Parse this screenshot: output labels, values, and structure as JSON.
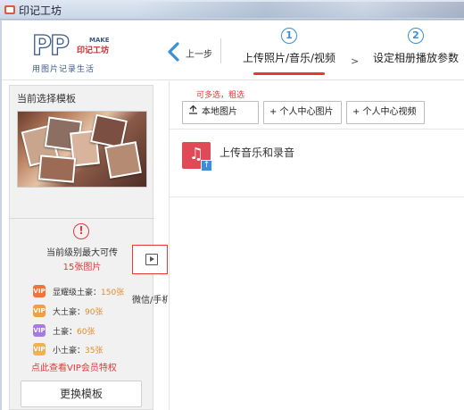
{
  "window": {
    "title": "印记工坊"
  },
  "logo": {
    "pp": "PP",
    "make": "MAKE",
    "brand": "印记工坊",
    "slogan": "用图片记录生活"
  },
  "nav": {
    "back_label": "上一步"
  },
  "steps": [
    {
      "num": "1",
      "label": "上传照片/音乐/视频"
    },
    {
      "num": "2",
      "label": "设定相册播放参数"
    }
  ],
  "steps_arrow": ">",
  "sidebar": {
    "title": "当前选择模板",
    "warning_icon": "!",
    "limit_line1": "当前级别最大可传",
    "limit_line2": "15张图片",
    "tiers": [
      {
        "icon_text": "VIP",
        "label": "显耀级土豪：",
        "count": "150张",
        "color": "#f0743a"
      },
      {
        "icon_text": "VIP",
        "label": "大土豪：",
        "count": "90张",
        "color": "#f0a040"
      },
      {
        "icon_text": "VIP",
        "label": "土豪：",
        "count": "60张",
        "color": "#a67be0"
      },
      {
        "icon_text": "VIP",
        "label": "小土豪：",
        "count": "35张",
        "color": "#f2b24a"
      }
    ],
    "vip_link": "点此查看VIP会员特权",
    "change_button": "更换模板"
  },
  "float": {
    "wechat_label": "微信/手机"
  },
  "toolbar": {
    "multi_hint": "可多选，粗选",
    "local_images": "本地图片",
    "center_images": "+ 个人中心图片",
    "center_videos": "+ 个人中心视频"
  },
  "music": {
    "label": "上传音乐和录音"
  },
  "colors": {
    "accent_blue": "#3b8fd6",
    "accent_red": "#e23a3a",
    "music_red": "#e04a57"
  }
}
